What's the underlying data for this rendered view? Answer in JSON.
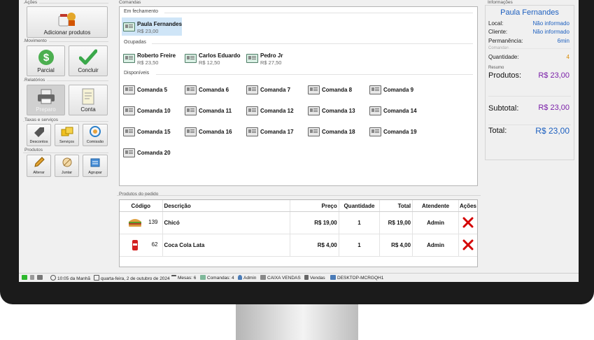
{
  "left": {
    "acoes_title": "Ações",
    "add_label": "Adicionar produtos",
    "movimento_title": "Movimento",
    "parcial_label": "Parcial",
    "concluir_label": "Concluir",
    "relatorios_title": "Relatórios",
    "preparo_label": "Preparo",
    "conta_label": "Conta",
    "taxas_title": "Taxas e serviços",
    "descontos_label": "Descontos",
    "servicos_label": "Serviços",
    "comissao_label": "Comissão",
    "produtos_title": "Produtos",
    "alterar_label": "Alterar",
    "juntar_label": "Juntar",
    "agrupar_label": "Agrupar"
  },
  "comandas": {
    "title": "Comandas",
    "fechamento_title": "Em fechamento",
    "fechamento": [
      {
        "name": "Paula Fernandes",
        "value": "R$ 23,00"
      }
    ],
    "ocupadas_title": "Ocupadas",
    "ocupadas": [
      {
        "name": "Roberto Freire",
        "value": "R$ 23,50"
      },
      {
        "name": "Carlos Eduardo",
        "value": "R$ 12,50"
      },
      {
        "name": "Pedro Jr",
        "value": "R$ 27,50"
      }
    ],
    "disponiveis_title": "Disponíveis",
    "disponiveis": [
      "Comanda 5",
      "Comanda 6",
      "Comanda 7",
      "Comanda 8",
      "Comanda 9",
      "Comanda 10",
      "Comanda 11",
      "Comanda 12",
      "Comanda 13",
      "Comanda 14",
      "Comanda 15",
      "Comanda 16",
      "Comanda 17",
      "Comanda 18",
      "Comanda 19",
      "Comanda 20"
    ]
  },
  "info": {
    "title": "Informações",
    "name": "Paula Fernandes",
    "local_label": "Local:",
    "local_value": "Não informado",
    "cliente_label": "Cliente:",
    "cliente_value": "Não informado",
    "permanencia_label": "Permanência:",
    "permanencia_value": "6min",
    "comandas_label": "Comandas",
    "quantidade_label": "Quantidade:",
    "quantidade_value": "4",
    "resumo_title": "Resumo",
    "produtos_label": "Produtos:",
    "produtos_value": "R$ 23,00",
    "subtotal_label": "Subtotal:",
    "subtotal_value": "R$ 23,00",
    "total_label": "Total:",
    "total_value": "R$ 23,00"
  },
  "produtos_pedido": {
    "title": "Produtos do pedido",
    "headers": {
      "codigo": "Código",
      "descricao": "Descrição",
      "preco": "Preço",
      "quantidade": "Quantidade",
      "total": "Total",
      "atendente": "Atendente",
      "acoes": "Ações"
    },
    "rows": [
      {
        "icon": "sandwich-icon",
        "codigo": "139",
        "descricao": "Chicó",
        "preco": "R$ 19,00",
        "quantidade": "1",
        "total": "R$ 19,00",
        "atendente": "Admin"
      },
      {
        "icon": "soda-can-icon",
        "codigo": "62",
        "descricao": "Coca Cola Lata",
        "preco": "R$ 4,00",
        "quantidade": "1",
        "total": "R$ 4,00",
        "atendente": "Admin"
      }
    ]
  },
  "status": {
    "time": "10:05 da Manhã",
    "date": "quarta-feira, 2 de outubro de 2024",
    "mesas": "Mesas: 6",
    "comandas": "Comandas: 4",
    "user": "Admin",
    "caixa": "CAIXA VENDAS",
    "vendas": "Vendas",
    "desktop": "DESKTOP-MCRGQH1"
  },
  "colors": {
    "accent_blue": "#1c5fbf",
    "purple": "#7a1fa8",
    "orange": "#d98a00",
    "delete_red": "#d40000",
    "selected": "#cfe5f7"
  }
}
